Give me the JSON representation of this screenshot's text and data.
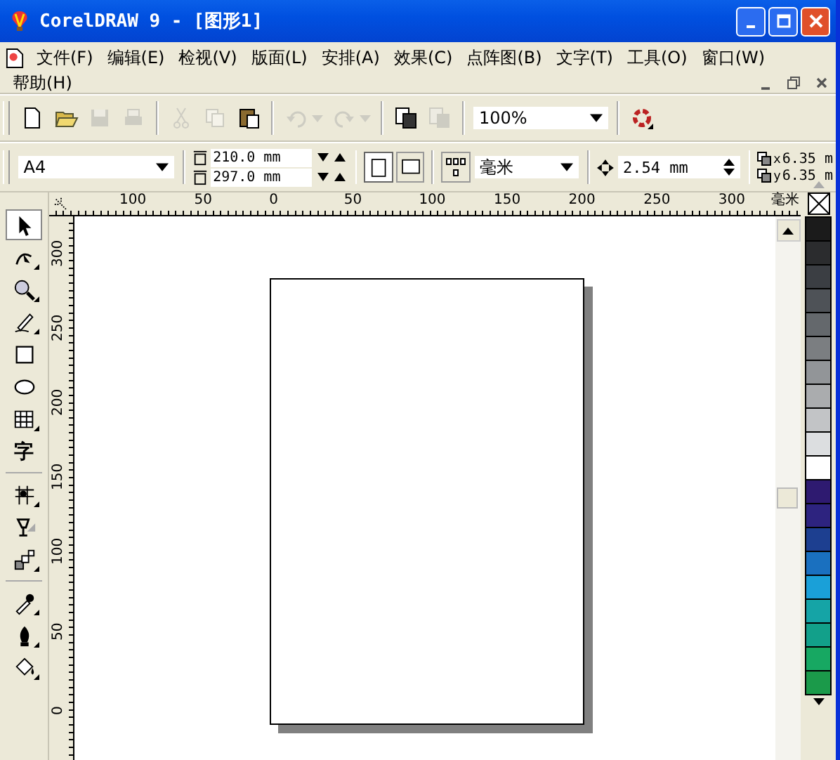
{
  "window": {
    "title": "CorelDRAW 9 - [图形1]"
  },
  "menu": [
    "文件(F)",
    "编辑(E)",
    "检视(V)",
    "版面(L)",
    "安排(A)",
    "效果(C)",
    "点阵图(B)",
    "文字(T)",
    "工具(O)",
    "窗口(W)",
    "帮助(H)"
  ],
  "toolbar": [
    {
      "kind": "new",
      "disabled": false
    },
    {
      "kind": "open",
      "disabled": false
    },
    {
      "kind": "save",
      "disabled": true
    },
    {
      "kind": "print",
      "disabled": true
    },
    {
      "kind": "sep"
    },
    {
      "kind": "cut",
      "disabled": true
    },
    {
      "kind": "copy",
      "disabled": true
    },
    {
      "kind": "paste",
      "disabled": false
    },
    {
      "kind": "sep"
    },
    {
      "kind": "undo",
      "disabled": true
    },
    {
      "kind": "redo",
      "disabled": true
    },
    {
      "kind": "sep"
    },
    {
      "kind": "import",
      "disabled": false
    },
    {
      "kind": "export",
      "disabled": true
    },
    {
      "kind": "sep"
    },
    {
      "kind": "zoom",
      "value": "100%"
    },
    {
      "kind": "sep"
    },
    {
      "kind": "launcher",
      "disabled": false
    }
  ],
  "property_bar": {
    "paper": "A4",
    "width": "210.0 mm",
    "height": "297.0 mm",
    "orientation": [
      {
        "kind": "portrait",
        "selected": true
      },
      {
        "kind": "landscape",
        "selected": false
      }
    ],
    "units": "毫米",
    "nudge": "2.54 mm",
    "duplicate": [
      {
        "axis": "x",
        "value": "6.35 m"
      },
      {
        "axis": "y",
        "value": "6.35 m"
      }
    ]
  },
  "toolbox": [
    {
      "kind": "pick",
      "selected": true,
      "flyout": false
    },
    {
      "kind": "shape",
      "selected": false,
      "flyout": true
    },
    {
      "kind": "zoom",
      "selected": false,
      "flyout": true
    },
    {
      "kind": "freehand",
      "selected": false,
      "flyout": true
    },
    {
      "kind": "rectangle",
      "selected": false,
      "flyout": false
    },
    {
      "kind": "ellipse",
      "selected": false,
      "flyout": false
    },
    {
      "kind": "grid",
      "selected": false,
      "flyout": true
    },
    {
      "kind": "text",
      "label": "字",
      "selected": false,
      "flyout": false
    },
    {
      "kind": "sep"
    },
    {
      "kind": "fill-grid",
      "selected": false,
      "flyout": true
    },
    {
      "kind": "transparency",
      "selected": false,
      "flyout": false
    },
    {
      "kind": "blend",
      "selected": false,
      "flyout": true
    },
    {
      "kind": "sep"
    },
    {
      "kind": "eyedropper",
      "selected": false,
      "flyout": true
    },
    {
      "kind": "pen",
      "selected": false,
      "flyout": true
    },
    {
      "kind": "bucket",
      "selected": false,
      "flyout": true
    }
  ],
  "horizontal_ruler": [
    "100",
    "50",
    "0",
    "50",
    "100",
    "150",
    "200",
    "250",
    "300"
  ],
  "ruler_unit": "毫米",
  "vertical_ruler": [
    "300",
    "250",
    "200",
    "150",
    "100",
    "50",
    "0"
  ],
  "palette": [
    {
      "color": "#1b1b1b"
    },
    {
      "color": "#2b2c2e"
    },
    {
      "color": "#3b3e43"
    },
    {
      "color": "#4e5257"
    },
    {
      "color": "#64686c"
    },
    {
      "color": "#7b7e81"
    },
    {
      "color": "#929598"
    },
    {
      "color": "#aaacae"
    },
    {
      "color": "#c2c4c6"
    },
    {
      "color": "#dcdee0"
    },
    {
      "color": "#ffffff"
    },
    {
      "color": "#2e1a70"
    },
    {
      "color": "#2d237f"
    },
    {
      "color": "#1d3f90"
    },
    {
      "color": "#1a70bf"
    },
    {
      "color": "#1aa0d8"
    },
    {
      "color": "#15a4a6"
    },
    {
      "color": "#12a08a"
    },
    {
      "color": "#17a862"
    },
    {
      "color": "#1b9a4a"
    }
  ]
}
